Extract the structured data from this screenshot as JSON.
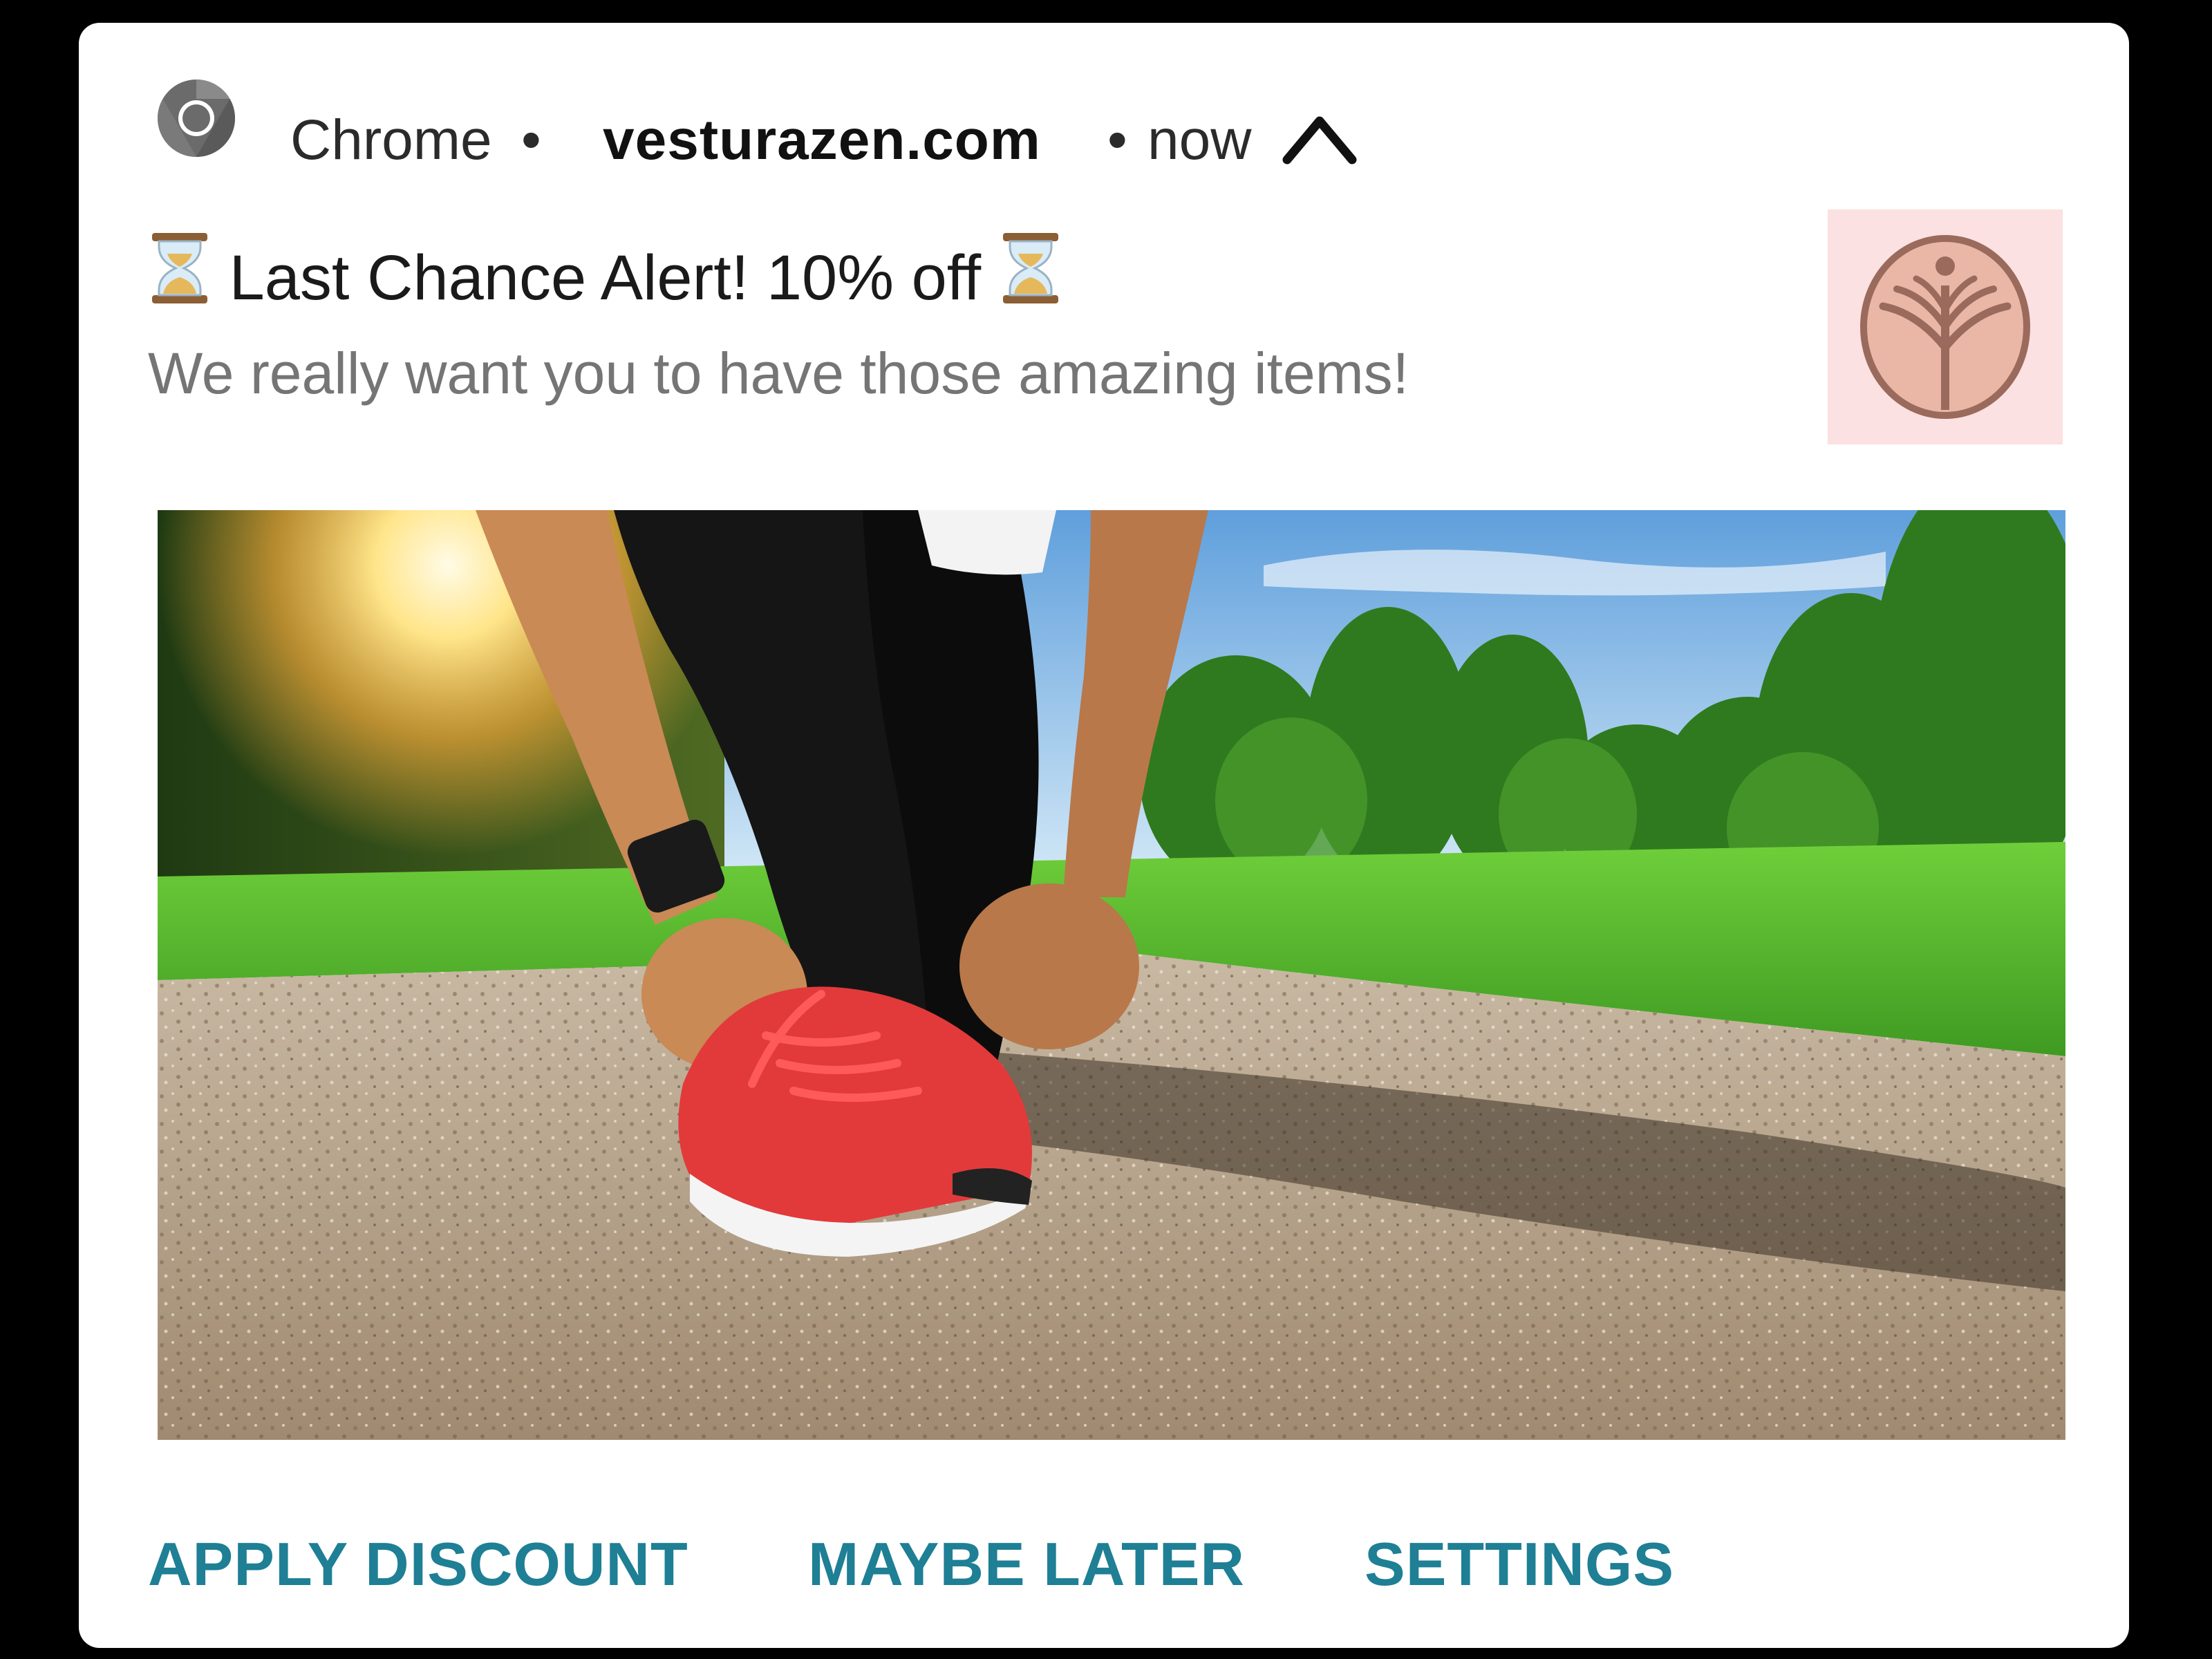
{
  "notification": {
    "app_name": "Chrome",
    "separator": "•",
    "domain": "vesturazen.com",
    "time": "now",
    "title": "Last Chance Alert! 10% off",
    "body": "We really want you to have those amazing items!",
    "icons": {
      "app": "chrome-icon",
      "expand": "chevron-up-icon",
      "title_prefix": "hourglass-icon",
      "title_suffix": "hourglass-icon",
      "brand_logo": "tree-logo"
    },
    "colors": {
      "action_text": "#1e7f95",
      "title_text": "#1a1a1a",
      "body_text": "#757575",
      "logo_background": "#fbe1e1",
      "logo_stroke": "#9a6a5c"
    }
  },
  "actions": {
    "apply": "APPLY DISCOUNT",
    "later": "MAYBE LATER",
    "settings": "SETTINGS"
  }
}
